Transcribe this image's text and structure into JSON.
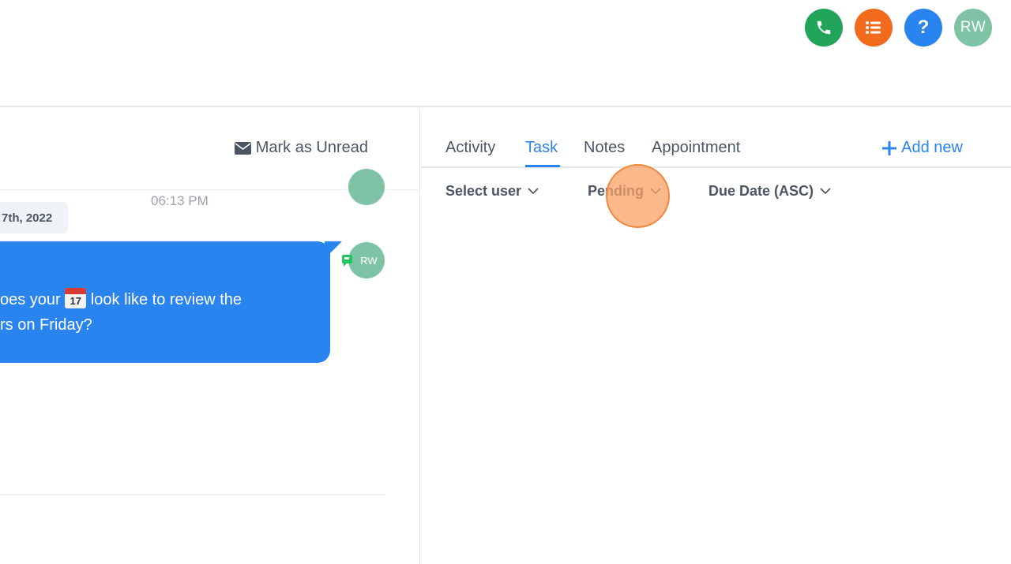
{
  "header": {
    "actions": [
      {
        "name": "phone-icon",
        "color": "#22a55a"
      },
      {
        "name": "list-icon",
        "color": "#f26b1d"
      },
      {
        "name": "help-icon",
        "color": "#2a84f0",
        "label": "?"
      }
    ],
    "avatar_initials": "RW"
  },
  "conversation": {
    "mark_unread_label": "Mark as Unread",
    "message_time": "06:13 PM",
    "date_label": "7th, 2022",
    "message_line1_before": "oes your ",
    "message_calendar_day": "17",
    "message_line1_after": " look like to review the",
    "message_line2": "rs on Friday?",
    "sender_initials": "RW"
  },
  "panel": {
    "tabs": [
      "Activity",
      "Task",
      "Notes",
      "Appointment"
    ],
    "active_tab": "Task",
    "add_new_label": "Add new",
    "filters": {
      "user": "Select user",
      "status": "Pending",
      "sort": "Due Date (ASC)"
    }
  }
}
